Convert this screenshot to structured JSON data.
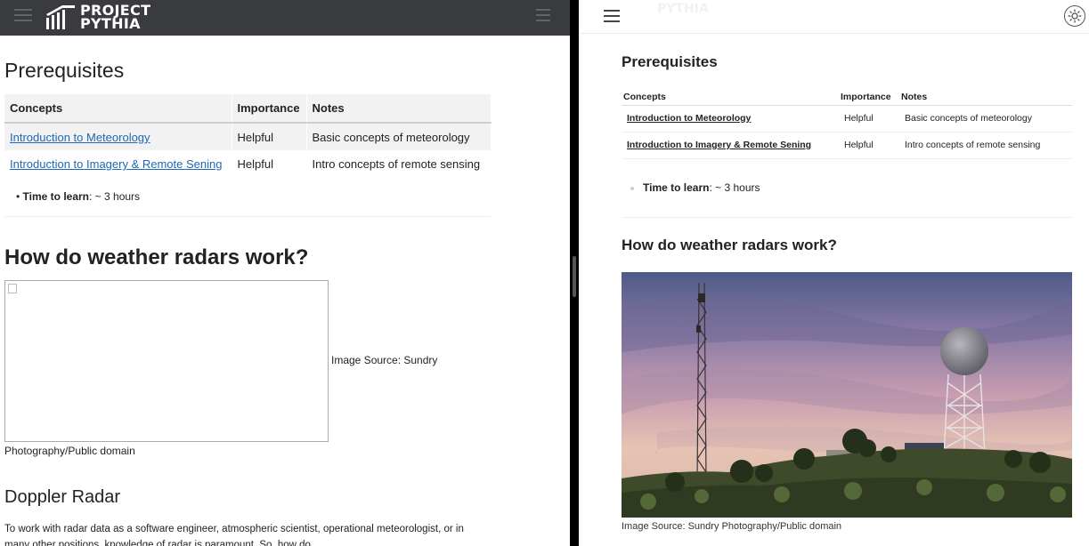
{
  "left": {
    "logo_text_line1": "PROJECT",
    "logo_text_line2": "PYTHIA",
    "prereq_heading": "Prerequisites",
    "table": {
      "headers": [
        "Concepts",
        "Importance",
        "Notes"
      ],
      "rows": [
        {
          "concept": "Introduction to Meteorology",
          "importance": "Helpful",
          "notes": "Basic concepts of meteorology"
        },
        {
          "concept": "Introduction to Imagery & Remote Sening",
          "importance": "Helpful",
          "notes": "Intro concepts of remote sensing"
        }
      ]
    },
    "time_label": "Time to learn",
    "time_value": ": ~ 3 hours",
    "section_heading": "How do weather radars work?",
    "image_caption_part1": "Image Source: Sundry",
    "image_caption_part2": "Photography/Public domain",
    "doppler_heading": "Doppler Radar",
    "paragraph": "To work with radar data as a software engineer, atmospheric scientist, operational meteorologist, or in many other positions, knowledge of radar is paramount. So, how do"
  },
  "right": {
    "ghost_logo_text": "PYTHIA",
    "prereq_heading": "Prerequisites",
    "table": {
      "headers": [
        "Concepts",
        "Importance",
        "Notes"
      ],
      "rows": [
        {
          "concept": "Introduction to Meteorology",
          "importance": "Helpful",
          "notes": "Basic concepts of meteorology"
        },
        {
          "concept": "Introduction to Imagery & Remote Sening",
          "importance": "Helpful",
          "notes": "Intro concepts of remote sensing"
        }
      ]
    },
    "time_label": "Time to learn",
    "time_value": ": ~ 3 hours",
    "section_heading": "How do weather radars work?",
    "image_caption": "Image Source: Sundry Photography/Public domain"
  },
  "icons": {
    "left_menu": "hamburger-icon",
    "left_toc": "toc-icon",
    "logo": "pythia-logo-icon",
    "right_menu": "hamburger-icon",
    "theme": "sun-icon"
  },
  "colors": {
    "header_dark": "#3a3b3f",
    "link_blue": "#1f68b5",
    "table_header_bg": "#f2f2f2"
  }
}
